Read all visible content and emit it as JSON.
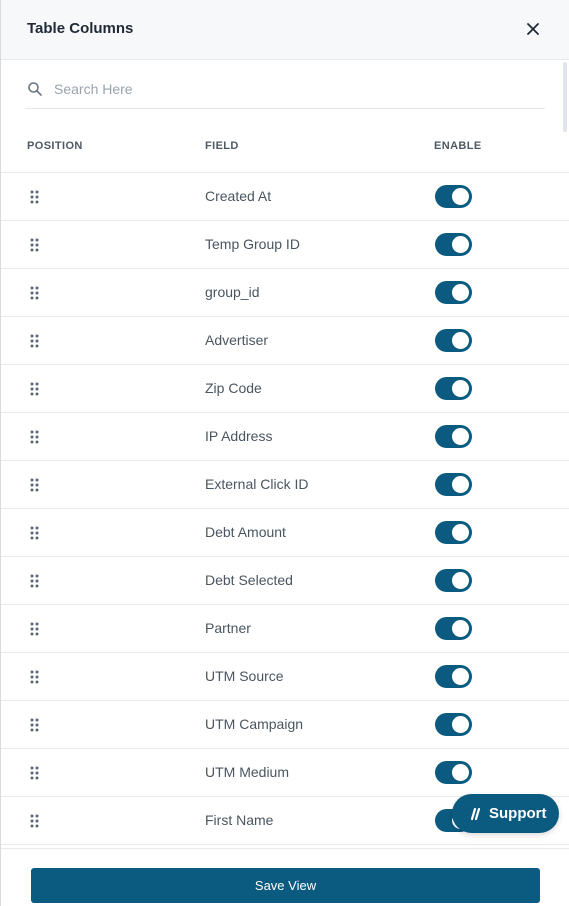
{
  "colors": {
    "accent": "#0b5a80",
    "toggle_on": "#0b5a80",
    "support_bg": "#0b5a80"
  },
  "header": {
    "title": "Table Columns",
    "close_icon": "close-icon"
  },
  "search": {
    "placeholder": "Search Here",
    "value": "",
    "icon": "search-icon"
  },
  "columns": {
    "position": "POSITION",
    "field": "FIELD",
    "enable": "ENABLE"
  },
  "rows": [
    {
      "field": "Created At",
      "enabled": true
    },
    {
      "field": "Temp Group ID",
      "enabled": true
    },
    {
      "field": "group_id",
      "enabled": true
    },
    {
      "field": "Advertiser",
      "enabled": true
    },
    {
      "field": "Zip Code",
      "enabled": true
    },
    {
      "field": "IP Address",
      "enabled": true
    },
    {
      "field": "External Click ID",
      "enabled": true
    },
    {
      "field": "Debt Amount",
      "enabled": true
    },
    {
      "field": "Debt Selected",
      "enabled": true
    },
    {
      "field": "Partner",
      "enabled": true
    },
    {
      "field": "UTM Source",
      "enabled": true
    },
    {
      "field": "UTM Campaign",
      "enabled": true
    },
    {
      "field": "UTM Medium",
      "enabled": true
    },
    {
      "field": "First Name",
      "enabled": true
    },
    {
      "field": "",
      "enabled": true
    }
  ],
  "footer": {
    "save_label": "Save View"
  },
  "support": {
    "label": "Support",
    "icon": "support-slash-icon"
  }
}
